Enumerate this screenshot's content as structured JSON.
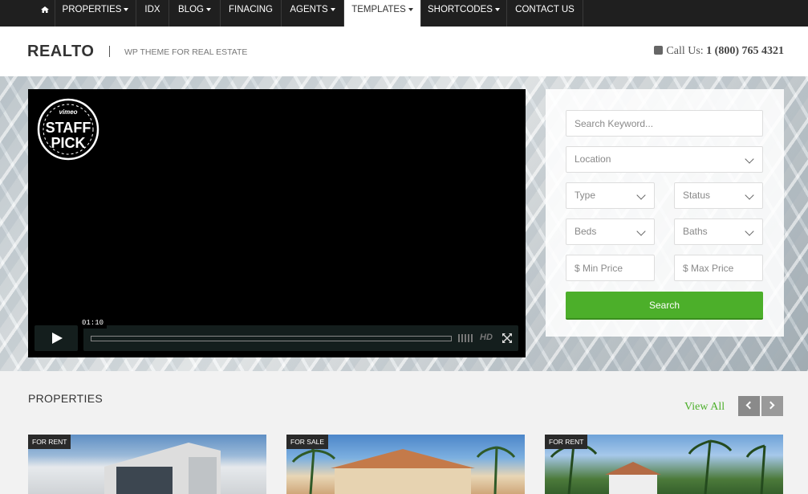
{
  "nav": {
    "items": [
      {
        "label": "PROPERTIES",
        "dropdown": true
      },
      {
        "label": "IDX",
        "dropdown": false
      },
      {
        "label": "BLOG",
        "dropdown": true
      },
      {
        "label": "FINACING",
        "dropdown": false
      },
      {
        "label": "AGENTS",
        "dropdown": true
      },
      {
        "label": "TEMPLATES",
        "dropdown": true,
        "active": true
      },
      {
        "label": "SHORTCODES",
        "dropdown": true
      },
      {
        "label": "CONTACT US",
        "dropdown": false
      }
    ],
    "home_icon": "home-icon"
  },
  "header": {
    "brand": "REALTO",
    "tagline": "WP THEME FOR REAL ESTATE",
    "call_prefix": "Call Us:",
    "phone": "1 (800) 765 4321",
    "phone_icon": "phone-icon"
  },
  "video": {
    "badge_top": "vimeo",
    "badge_line1": "STAFF",
    "badge_line2": "PICK",
    "time": "01:10",
    "hd_label": "HD"
  },
  "search": {
    "keyword_placeholder": "Search Keyword...",
    "location": "Location",
    "type": "Type",
    "status": "Status",
    "beds": "Beds",
    "baths": "Baths",
    "min_price_placeholder": "$ Min Price",
    "max_price_placeholder": "$ Max Price",
    "button": "Search"
  },
  "properties": {
    "title": "PROPERTIES",
    "view_all": "View All",
    "cards": [
      {
        "tag": "FOR RENT"
      },
      {
        "tag": "FOR SALE"
      },
      {
        "tag": "FOR RENT"
      }
    ]
  },
  "colors": {
    "accent": "#4caf2a",
    "nav_bg": "#1f1f1f"
  }
}
